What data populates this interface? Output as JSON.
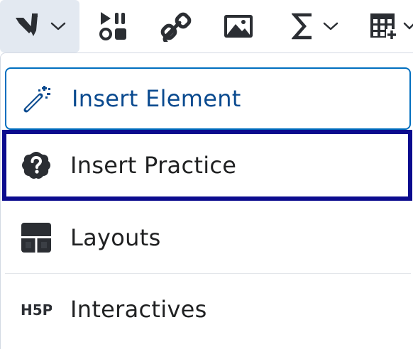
{
  "toolbar": {
    "buttons": [
      {
        "icon": "pen-icon",
        "has_dropdown": true,
        "active": true
      },
      {
        "icon": "media-icon",
        "has_dropdown": false
      },
      {
        "icon": "link-icon",
        "has_dropdown": false
      },
      {
        "icon": "image-icon",
        "has_dropdown": false
      },
      {
        "icon": "sigma-icon",
        "has_dropdown": true
      },
      {
        "icon": "table-icon",
        "has_dropdown": true
      }
    ]
  },
  "menu": {
    "items": [
      {
        "label": "Insert Element",
        "icon": "magic-wand-icon",
        "state": "focused"
      },
      {
        "label": "Insert Practice",
        "icon": "question-cloud-icon",
        "state": "highlighted"
      },
      {
        "label": "Layouts",
        "icon": "layouts-icon"
      },
      {
        "label": "Interactives",
        "icon": "h5p-icon"
      }
    ]
  },
  "colors": {
    "accent_blue": "#006fbf",
    "focus_ring": "#0b0b8e",
    "icon_dark": "#2b2e33",
    "toolbar_active_bg": "#e3e9f1"
  }
}
